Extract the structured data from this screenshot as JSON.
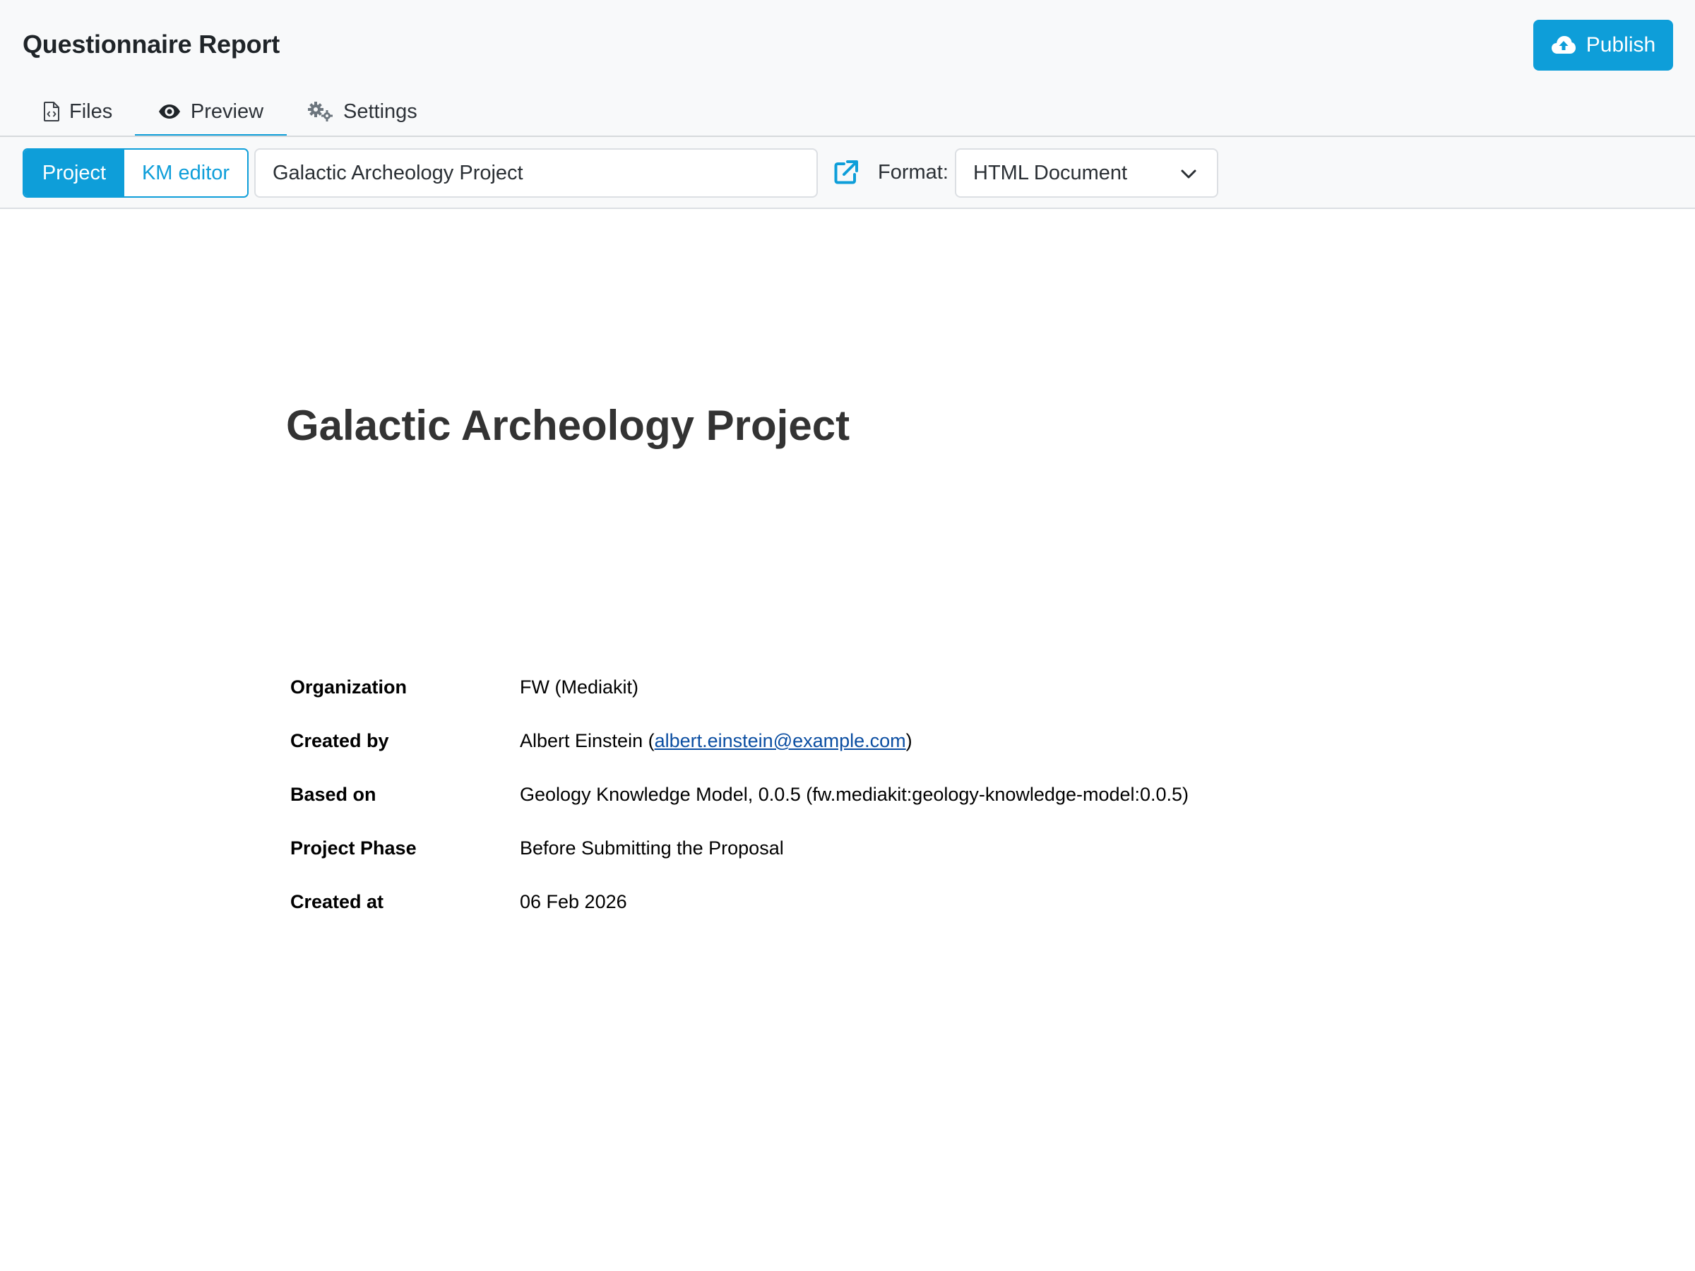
{
  "header": {
    "title": "Questionnaire Report",
    "publish_label": "Publish"
  },
  "tabs": [
    {
      "label": "Files",
      "icon": "file-code-icon"
    },
    {
      "label": "Preview",
      "icon": "eye-icon",
      "active": true
    },
    {
      "label": "Settings",
      "icon": "gears-icon"
    }
  ],
  "toolbar": {
    "source_options": [
      {
        "label": "Project",
        "active": true
      },
      {
        "label": "KM editor",
        "active": false
      }
    ],
    "selected_project": "Galactic Archeology Project",
    "format_label": "Format:",
    "format_value": "HTML Document"
  },
  "document": {
    "title": "Galactic Archeology Project",
    "fields": [
      {
        "key": "Organization",
        "value": "FW (Mediakit)"
      },
      {
        "key": "Created by",
        "value_prefix": "Albert Einstein (",
        "link": "albert.einstein@example.com",
        "value_suffix": ")"
      },
      {
        "key": "Based on",
        "value": "Geology Knowledge Model, 0.0.5 (fw.mediakit:geology-knowledge-model:0.0.5)"
      },
      {
        "key": "Project Phase",
        "value": "Before Submitting the Proposal"
      },
      {
        "key": "Created at",
        "value": "06 Feb 2026"
      }
    ]
  },
  "colors": {
    "accent": "#0e9ed9",
    "header_bg": "#f8f9fa",
    "link": "#0b4ea2"
  }
}
